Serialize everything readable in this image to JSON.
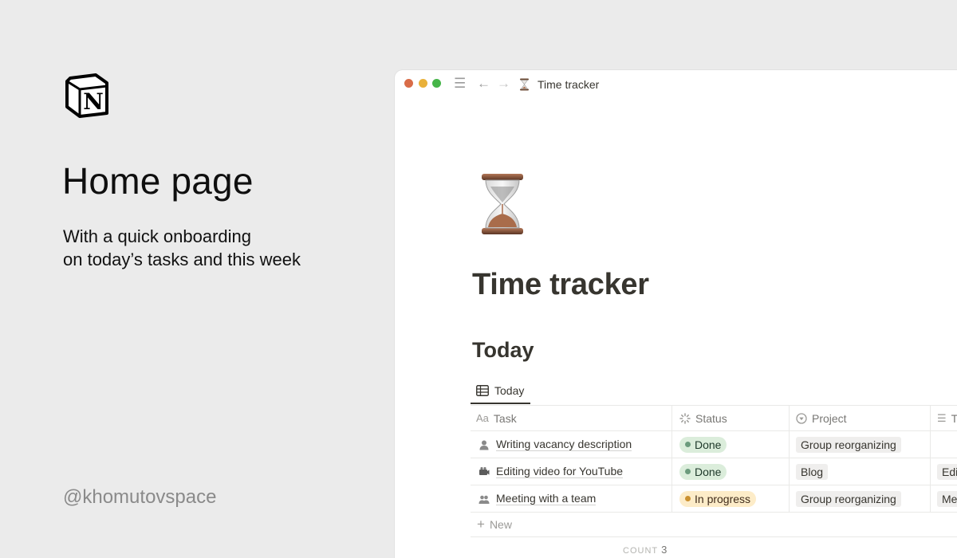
{
  "promo": {
    "headline": "Home page",
    "subline_1": "With a quick onboarding",
    "subline_2": "on today’s tasks and this week",
    "handle": "@khomutovspace",
    "logo_letter": "N"
  },
  "window": {
    "breadcrumb_title": "Time tracker",
    "page_title": "Time tracker",
    "page_icon": "hourglass-icon",
    "section_title": "Today",
    "view_tab": "Today"
  },
  "table": {
    "columns": [
      {
        "icon": "text-icon",
        "icon_text": "Aa",
        "label": "Task"
      },
      {
        "icon": "status-icon",
        "label": "Status"
      },
      {
        "icon": "select-icon",
        "label": "Project"
      },
      {
        "icon": "list-icon",
        "label": "T"
      }
    ],
    "rows": [
      {
        "icon": "person-icon",
        "task": "Writing vacancy description",
        "status": "Done",
        "project": "Group reorganizing",
        "extra": ""
      },
      {
        "icon": "camera-icon",
        "task": "Editing video for YouTube",
        "status": "Done",
        "project": "Blog",
        "extra": "Edi"
      },
      {
        "icon": "people-icon",
        "task": "Meeting with a team",
        "status": "In progress",
        "project": "Group reorganizing",
        "extra": "Me"
      }
    ],
    "new_label": "New",
    "count_label": "COUNT",
    "count_value": "3"
  },
  "colors": {
    "background": "#ebebeb",
    "done": "#dbeddb",
    "in_progress": "#fdecc8",
    "tag": "#efeeed"
  }
}
